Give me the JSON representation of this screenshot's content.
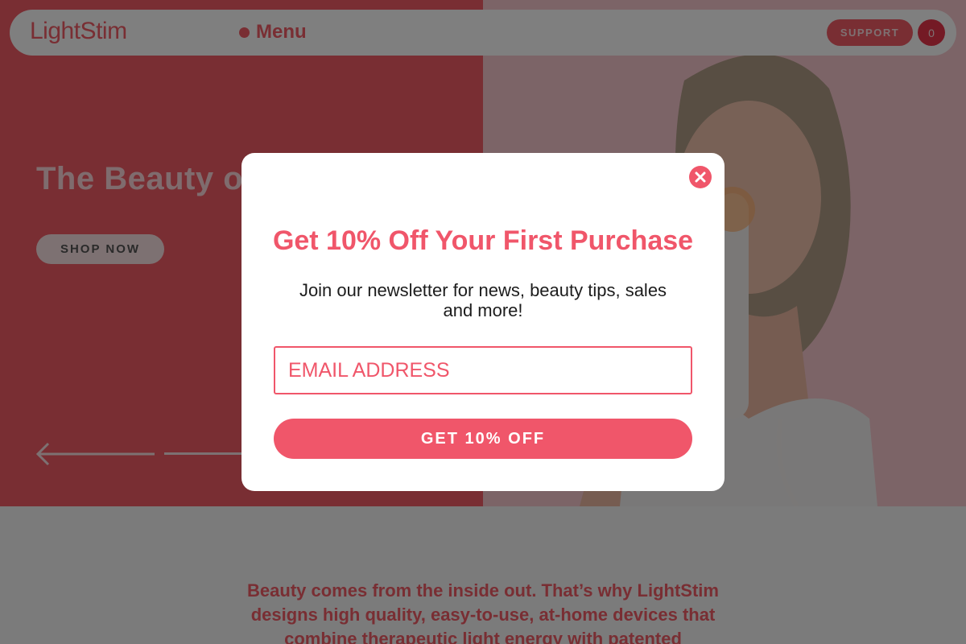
{
  "header": {
    "logo": "LightStim",
    "menu_label": "Menu",
    "support_label": "SUPPORT",
    "cart_count": "0"
  },
  "hero": {
    "title": "The Beauty of",
    "shop_label": "SHOP NOW"
  },
  "about": {
    "text": "Beauty comes from the inside out. That’s why LightStim designs high quality, easy-to-use, at-home devices that combine therapeutic light energy with patented"
  },
  "modal": {
    "title": "Get 10% Off Your First Purchase",
    "subtitle": "Join our newsletter for news, beauty tips, sales and more!",
    "email_placeholder": "EMAIL ADDRESS",
    "submit_label": "GET 10% OFF"
  },
  "colors": {
    "brand": "#f25c66",
    "accent": "#f0566a"
  },
  "icons": {
    "close": "close-icon",
    "arrow": "arrow-left-icon"
  }
}
